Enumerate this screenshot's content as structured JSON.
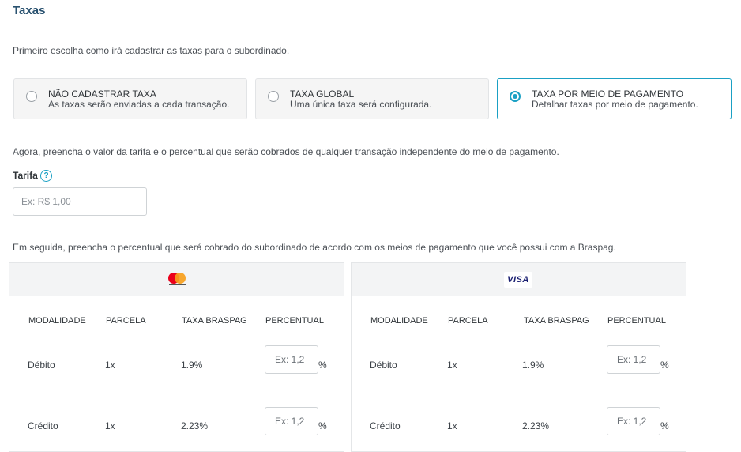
{
  "section_title": "Taxas",
  "intro": "Primeiro escolha como irá cadastrar as taxas para o subordinado.",
  "options": [
    {
      "title": "NÃO CADASTRAR TAXA",
      "desc": "As taxas serão enviadas a cada transação.",
      "selected": false
    },
    {
      "title": "TAXA GLOBAL",
      "desc": "Uma única taxa será configurada.",
      "selected": false
    },
    {
      "title": "TAXA POR MEIO DE PAGAMENTO",
      "desc": "Detalhar taxas por meio de pagamento.",
      "selected": true
    }
  ],
  "para2": "Agora, preencha o valor da tarifa e o percentual que serão cobrados de qualquer transação independente do meio de pagamento.",
  "tarifa": {
    "label": "Tarifa",
    "placeholder": "Ex: R$ 1,00",
    "help_icon": "question-circle-icon"
  },
  "para3": "Em seguida, preencha o percentual que será cobrado do subordinado de acordo com os meios de pagamento que você possui com a Braspag.",
  "table_headers": [
    "MODALIDADE",
    "PARCELA",
    "TAXA BRASPAG",
    "PERCENTUAL"
  ],
  "cards": [
    {
      "brand": "Mastercard",
      "brand_icon": "mastercard-logo-icon",
      "rows": [
        {
          "modalidade": "Débito",
          "parcela": "1x",
          "taxa": "1.9%",
          "placeholder": "Ex: 1,2",
          "pct": "%"
        },
        {
          "modalidade": "Crédito",
          "parcela": "1x",
          "taxa": "2.23%",
          "placeholder": "Ex: 1,2",
          "pct": "%"
        }
      ]
    },
    {
      "brand": "VISA",
      "brand_icon": "visa-logo-icon",
      "rows": [
        {
          "modalidade": "Débito",
          "parcela": "1x",
          "taxa": "1.9%",
          "placeholder": "Ex: 1,2",
          "pct": "%"
        },
        {
          "modalidade": "Crédito",
          "parcela": "1x",
          "taxa": "2.23%",
          "placeholder": "Ex: 1,2",
          "pct": "%"
        }
      ]
    }
  ],
  "colors": {
    "accent": "#1aa0c4",
    "title": "#2a5270"
  }
}
